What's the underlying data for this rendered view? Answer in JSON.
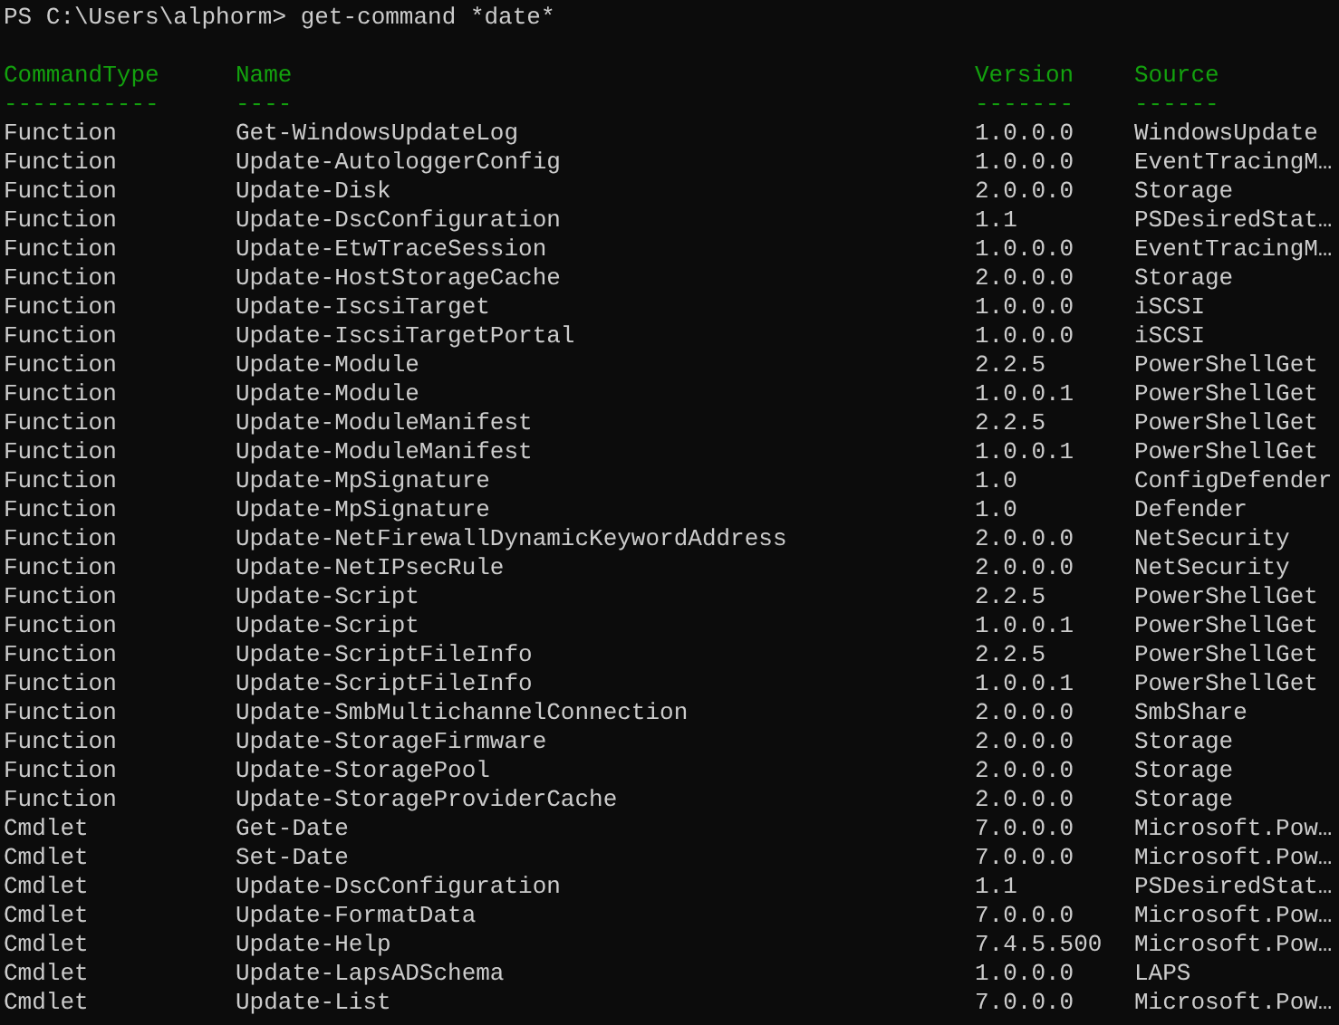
{
  "prompt": {
    "path": "PS C:\\Users\\alphorm>",
    "command": "get-command *date*"
  },
  "table": {
    "columns": [
      {
        "label": "CommandType",
        "rule": "-----------"
      },
      {
        "label": "Name",
        "rule": "----"
      },
      {
        "label": "Version",
        "rule": "-------"
      },
      {
        "label": "Source",
        "rule": "------"
      }
    ],
    "rows": [
      [
        "Function",
        "Get-WindowsUpdateLog",
        "1.0.0.0",
        "WindowsUpdate"
      ],
      [
        "Function",
        "Update-AutologgerConfig",
        "1.0.0.0",
        "EventTracingM…"
      ],
      [
        "Function",
        "Update-Disk",
        "2.0.0.0",
        "Storage"
      ],
      [
        "Function",
        "Update-DscConfiguration",
        "1.1",
        "PSDesiredStat…"
      ],
      [
        "Function",
        "Update-EtwTraceSession",
        "1.0.0.0",
        "EventTracingM…"
      ],
      [
        "Function",
        "Update-HostStorageCache",
        "2.0.0.0",
        "Storage"
      ],
      [
        "Function",
        "Update-IscsiTarget",
        "1.0.0.0",
        "iSCSI"
      ],
      [
        "Function",
        "Update-IscsiTargetPortal",
        "1.0.0.0",
        "iSCSI"
      ],
      [
        "Function",
        "Update-Module",
        "2.2.5",
        "PowerShellGet"
      ],
      [
        "Function",
        "Update-Module",
        "1.0.0.1",
        "PowerShellGet"
      ],
      [
        "Function",
        "Update-ModuleManifest",
        "2.2.5",
        "PowerShellGet"
      ],
      [
        "Function",
        "Update-ModuleManifest",
        "1.0.0.1",
        "PowerShellGet"
      ],
      [
        "Function",
        "Update-MpSignature",
        "1.0",
        "ConfigDefender"
      ],
      [
        "Function",
        "Update-MpSignature",
        "1.0",
        "Defender"
      ],
      [
        "Function",
        "Update-NetFirewallDynamicKeywordAddress",
        "2.0.0.0",
        "NetSecurity"
      ],
      [
        "Function",
        "Update-NetIPsecRule",
        "2.0.0.0",
        "NetSecurity"
      ],
      [
        "Function",
        "Update-Script",
        "2.2.5",
        "PowerShellGet"
      ],
      [
        "Function",
        "Update-Script",
        "1.0.0.1",
        "PowerShellGet"
      ],
      [
        "Function",
        "Update-ScriptFileInfo",
        "2.2.5",
        "PowerShellGet"
      ],
      [
        "Function",
        "Update-ScriptFileInfo",
        "1.0.0.1",
        "PowerShellGet"
      ],
      [
        "Function",
        "Update-SmbMultichannelConnection",
        "2.0.0.0",
        "SmbShare"
      ],
      [
        "Function",
        "Update-StorageFirmware",
        "2.0.0.0",
        "Storage"
      ],
      [
        "Function",
        "Update-StoragePool",
        "2.0.0.0",
        "Storage"
      ],
      [
        "Function",
        "Update-StorageProviderCache",
        "2.0.0.0",
        "Storage"
      ],
      [
        "Cmdlet",
        "Get-Date",
        "7.0.0.0",
        "Microsoft.Pow…"
      ],
      [
        "Cmdlet",
        "Set-Date",
        "7.0.0.0",
        "Microsoft.Pow…"
      ],
      [
        "Cmdlet",
        "Update-DscConfiguration",
        "1.1",
        "PSDesiredStat…"
      ],
      [
        "Cmdlet",
        "Update-FormatData",
        "7.0.0.0",
        "Microsoft.Pow…"
      ],
      [
        "Cmdlet",
        "Update-Help",
        "7.4.5.500",
        "Microsoft.Pow…"
      ],
      [
        "Cmdlet",
        "Update-LapsADSchema",
        "1.0.0.0",
        "LAPS"
      ],
      [
        "Cmdlet",
        "Update-List",
        "7.0.0.0",
        "Microsoft.Pow…"
      ]
    ]
  }
}
